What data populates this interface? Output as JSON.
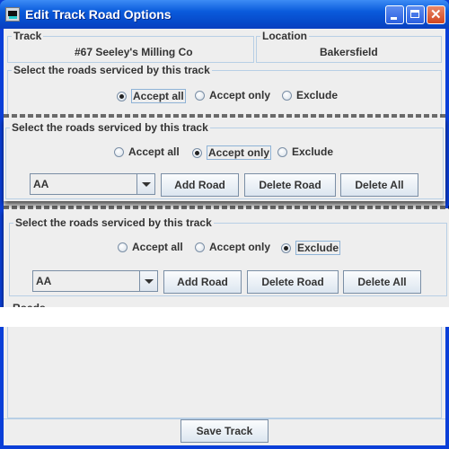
{
  "window": {
    "title": "Edit Track Road Options",
    "controls": [
      "minimize-icon",
      "maximize-icon",
      "close-icon"
    ]
  },
  "track": {
    "label": "Track",
    "value": "#67 Seeley's Milling Co"
  },
  "location": {
    "label": "Location",
    "value": "Bakersfield"
  },
  "panels": [
    {
      "label": "Select the roads serviced by this track",
      "options": [
        "Accept all",
        "Accept only",
        "Exclude"
      ],
      "selected": "Accept all"
    },
    {
      "label": "Select the roads serviced by this track",
      "options": [
        "Accept all",
        "Accept only",
        "Exclude"
      ],
      "selected": "Accept only",
      "road_select": "AA",
      "buttons": [
        "Add Road",
        "Delete Road",
        "Delete All"
      ]
    },
    {
      "label": "Select the roads serviced by this track",
      "options": [
        "Accept all",
        "Accept only",
        "Exclude"
      ],
      "selected": "Exclude",
      "road_select": "AA",
      "buttons": [
        "Add Road",
        "Delete Road",
        "Delete All"
      ],
      "roads_label": "Roads"
    }
  ],
  "save_button": "Save Track"
}
